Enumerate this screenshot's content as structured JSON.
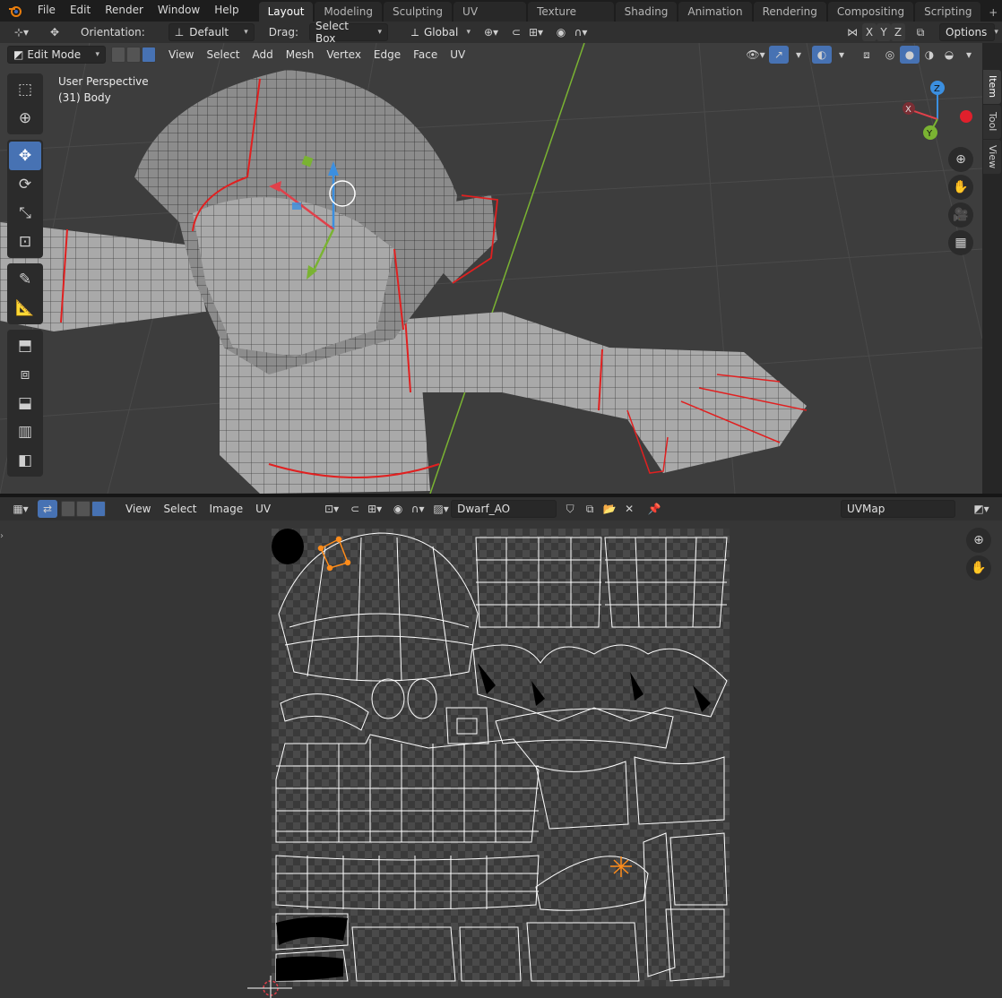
{
  "menu": {
    "items": [
      "File",
      "Edit",
      "Render",
      "Window",
      "Help"
    ]
  },
  "workspaces": {
    "tabs": [
      "Layout",
      "Modeling",
      "Sculpting",
      "UV Editing",
      "Texture Paint",
      "Shading",
      "Animation",
      "Rendering",
      "Compositing",
      "Scripting"
    ],
    "active": "Layout",
    "add": "+"
  },
  "toolheader": {
    "orientation_label": "Orientation:",
    "orientation_value": "Default",
    "drag_label": "Drag:",
    "drag_value": "Select Box",
    "transform_value": "Global",
    "axis_x": "X",
    "axis_y": "Y",
    "axis_z": "Z",
    "options_label": "Options"
  },
  "viewport": {
    "mode": "Edit Mode",
    "menus": [
      "View",
      "Select",
      "Add",
      "Mesh",
      "Vertex",
      "Edge",
      "Face",
      "UV"
    ],
    "overlay_line1": "User Perspective",
    "overlay_line2": "(31) Body",
    "gizmo_x": "X",
    "gizmo_y": "Y",
    "gizmo_z": "Z"
  },
  "sidebar_tabs": [
    "Item",
    "Tool",
    "View"
  ],
  "uv_editor": {
    "menus": [
      "View",
      "Select",
      "Image",
      "UV"
    ],
    "image_name": "Dwarf_AO",
    "uvmap_name": "UVMap"
  },
  "colors": {
    "accent": "#4772b3",
    "seam": "#e02020",
    "selection": "#ff8c1a",
    "axis_x": "#e0404a",
    "axis_y": "#7ab332",
    "axis_z": "#3b8fe0"
  },
  "icons": {
    "logo": "blender-logo-icon",
    "tools": [
      "select-box-icon",
      "cursor-icon",
      "move-icon",
      "rotate-icon",
      "scale-icon",
      "transform-icon",
      "annotate-icon",
      "measure-icon",
      "extrude-icon",
      "inset-icon",
      "bevel-icon",
      "loop-cut-icon",
      "knife-icon"
    ]
  }
}
